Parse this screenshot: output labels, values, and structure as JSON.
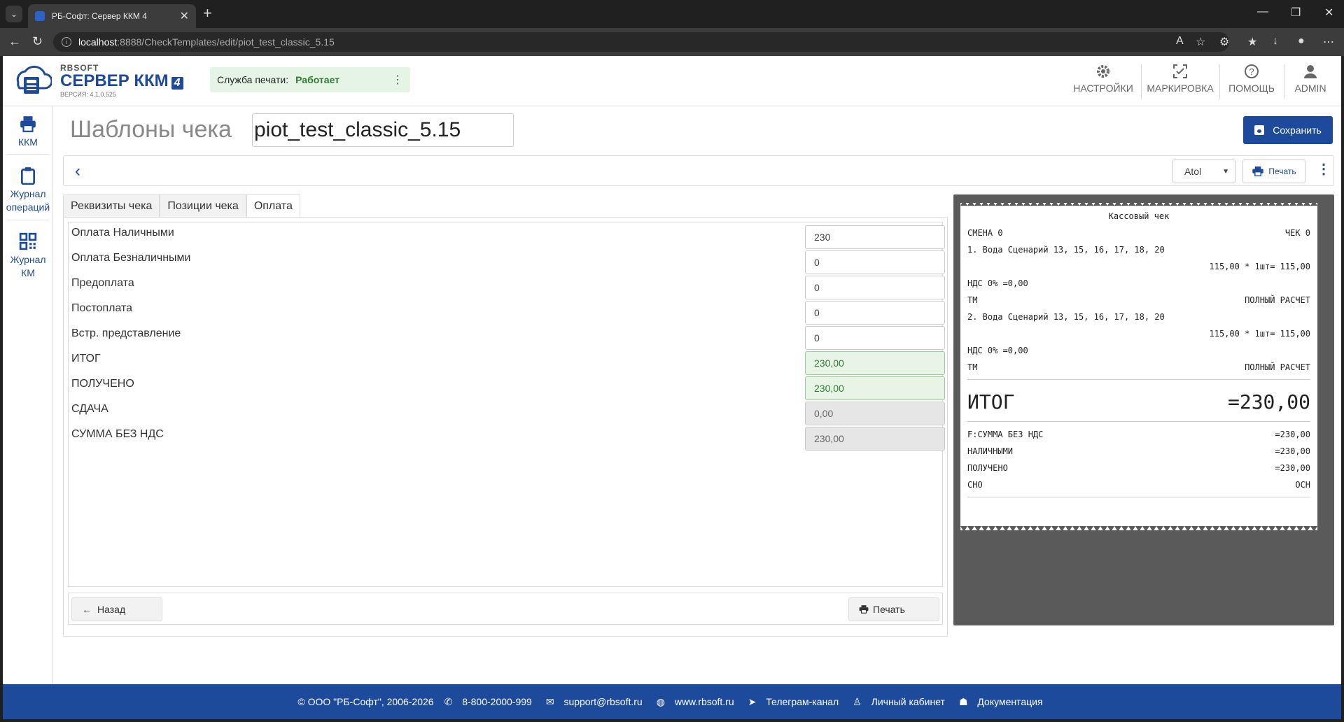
{
  "browser": {
    "tab_title": "РБ-Софт: Сервер ККМ 4",
    "url_host": "localhost",
    "url_path": ":8888/CheckTemplates/edit/piot_test_classic_5.15"
  },
  "header": {
    "brand_small": "RBSOFT",
    "brand_name": "СЕРВЕР ККМ",
    "brand_num": "4",
    "version": "ВЕРСИЯ: 4.1.0.525",
    "print_service_label": "Служба печати:",
    "print_service_status": "Работает",
    "nav": [
      {
        "label": "НАСТРОЙКИ",
        "icon": "gear-icon"
      },
      {
        "label": "МАРКИРОВКА",
        "icon": "scan-icon"
      },
      {
        "label": "ПОМОЩЬ",
        "icon": "help-icon"
      },
      {
        "label": "ADMIN",
        "icon": "user-icon"
      }
    ]
  },
  "sidebar": {
    "items": [
      {
        "label": "ККМ",
        "icon": "printer-icon"
      },
      {
        "label": "Журнал операций",
        "icon": "clipboard-icon"
      },
      {
        "label": "Журнал КМ",
        "icon": "qr-icon"
      }
    ]
  },
  "page": {
    "title": "Шаблоны чека",
    "template_name": "piot_test_classic_5.15",
    "save_label": "Сохранить"
  },
  "toolbar": {
    "driver": "Atol",
    "print_label": "Печать"
  },
  "tabs": [
    {
      "label": "Реквизиты чека",
      "active": false
    },
    {
      "label": "Позиции чека",
      "active": false
    },
    {
      "label": "Оплата",
      "active": true
    }
  ],
  "form": {
    "rows": [
      {
        "label": "Оплата Наличными",
        "value": "230",
        "style": "normal"
      },
      {
        "label": "Оплата Безналичными",
        "value": "0",
        "style": "normal"
      },
      {
        "label": "Предоплата",
        "value": "0",
        "style": "normal"
      },
      {
        "label": "Постоплата",
        "value": "0",
        "style": "normal"
      },
      {
        "label": "Встр. представление",
        "value": "0",
        "style": "normal"
      },
      {
        "label": "ИТОГ",
        "value": "230,00",
        "style": "green"
      },
      {
        "label": "ПОЛУЧЕНО",
        "value": "230,00",
        "style": "green"
      },
      {
        "label": "СДАЧА",
        "value": "0,00",
        "style": "grey"
      },
      {
        "label": "СУММА БЕЗ НДС",
        "value": "230,00",
        "style": "grey"
      }
    ],
    "back_label": "Назад",
    "print_label": "Печать"
  },
  "receipt": {
    "title": "Кассовый чек",
    "shift": "СМЕНА 0",
    "check": "ЧЕК 0",
    "item1": "1. Вода Сценарий 13, 15, 16, 17, 18, 20",
    "item1_price": "115,00 * 1шт= 115,00",
    "item1_vat": "НДС 0% =0,00",
    "item1_tm": "ТМ",
    "item1_mode": "ПОЛНЫЙ РАСЧЕТ",
    "item2": "2. Вода Сценарий 13, 15, 16, 17, 18, 20",
    "item2_price": "115,00 * 1шт= 115,00",
    "item2_vat": "НДС 0% =0,00",
    "item2_tm": "ТМ",
    "item2_mode": "ПОЛНЫЙ РАСЧЕТ",
    "total_label": "ИТОГ",
    "total_value": "=230,00",
    "summary": [
      {
        "label": "F:СУММА БЕЗ НДС",
        "value": "=230,00"
      },
      {
        "label": "НАЛИЧНЫМИ",
        "value": "=230,00"
      },
      {
        "label": "ПОЛУЧЕНО",
        "value": "=230,00"
      },
      {
        "label": "СНО",
        "value": "ОСН"
      }
    ]
  },
  "footer": {
    "copyright": "© ООО \"РБ-Софт\", 2006-2026",
    "phone": "8-800-2000-999",
    "email": "support@rbsoft.ru",
    "site": "www.rbsoft.ru",
    "telegram": "Телеграм-канал",
    "cabinet": "Личный кабинет",
    "docs": "Документация"
  },
  "colors": {
    "brand": "#1e4a9c",
    "status_ok": "#2e7d32"
  }
}
